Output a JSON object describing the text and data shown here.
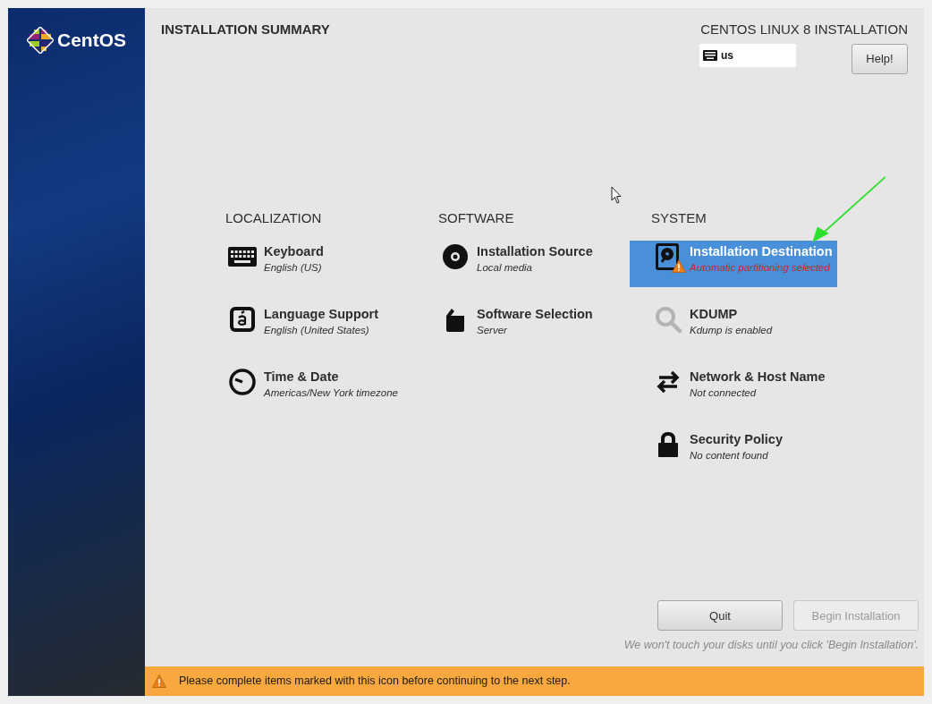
{
  "sidebar": {
    "logo_text": "CentOS"
  },
  "header": {
    "title": "INSTALLATION SUMMARY",
    "product": "CENTOS LINUX 8 INSTALLATION",
    "keyboard_layout": "us",
    "help_button": "Help!"
  },
  "sections": [
    {
      "heading": "LOCALIZATION",
      "items": [
        {
          "title": "Keyboard",
          "status": "English (US)",
          "selected": false,
          "warning": false,
          "greyed": false
        },
        {
          "title": "Language Support",
          "status": "English (United States)",
          "selected": false,
          "warning": false,
          "greyed": false
        },
        {
          "title": "Time & Date",
          "status": "Americas/New York timezone",
          "selected": false,
          "warning": false,
          "greyed": false
        }
      ]
    },
    {
      "heading": "SOFTWARE",
      "items": [
        {
          "title": "Installation Source",
          "status": "Local media",
          "selected": false,
          "warning": false,
          "greyed": false
        },
        {
          "title": "Software Selection",
          "status": "Server",
          "selected": false,
          "warning": false,
          "greyed": false
        }
      ]
    },
    {
      "heading": "SYSTEM",
      "items": [
        {
          "title": "Installation Destination",
          "status": "Automatic partitioning selected",
          "selected": true,
          "warning": true,
          "greyed": false
        },
        {
          "title": "KDUMP",
          "status": "Kdump is enabled",
          "selected": false,
          "warning": false,
          "greyed": true
        },
        {
          "title": "Network & Host Name",
          "status": "Not connected",
          "selected": false,
          "warning": false,
          "greyed": false
        },
        {
          "title": "Security Policy",
          "status": "No content found",
          "selected": false,
          "warning": false,
          "greyed": false
        }
      ]
    }
  ],
  "buttons": [
    {
      "label": "Quit",
      "disabled": false
    },
    {
      "label": "Begin Installation",
      "disabled": true
    }
  ],
  "note": "We won't touch your disks until you click 'Begin Installation'.",
  "warning_bar": {
    "message": "Please complete items marked with this icon before continuing to the next step."
  }
}
